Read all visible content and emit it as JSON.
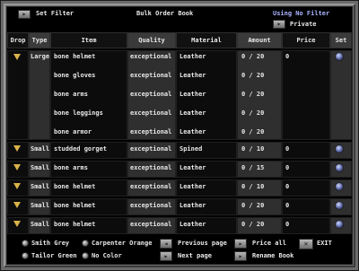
{
  "header": {
    "set_filter_label": "Set Filter",
    "title": "Bulk Order Book",
    "filter_status": "Using No Filter",
    "private_label": "Private"
  },
  "columns": [
    "Drop",
    "Type",
    "Item",
    "Quality",
    "Material",
    "Amount",
    "Price",
    "Set"
  ],
  "groups": [
    {
      "type": "Large",
      "items": [
        {
          "item": "bone helmet",
          "quality": "exceptional",
          "material": "Leather",
          "amount": "0 / 20",
          "price": "0"
        },
        {
          "item": "bone gloves",
          "quality": "exceptional",
          "material": "Leather",
          "amount": "0 / 20",
          "price": ""
        },
        {
          "item": "bone arms",
          "quality": "exceptional",
          "material": "Leather",
          "amount": "0 / 20",
          "price": ""
        },
        {
          "item": "bone leggings",
          "quality": "exceptional",
          "material": "Leather",
          "amount": "0 / 20",
          "price": ""
        },
        {
          "item": "bone armor",
          "quality": "exceptional",
          "material": "Leather",
          "amount": "0 / 20",
          "price": ""
        }
      ]
    },
    {
      "type": "Small",
      "items": [
        {
          "item": "studded gorget",
          "quality": "exceptional",
          "material": "Spined",
          "amount": "0 / 10",
          "price": "0"
        }
      ]
    },
    {
      "type": "Small",
      "items": [
        {
          "item": "bone arms",
          "quality": "exceptional",
          "material": "Leather",
          "amount": "0 / 15",
          "price": "0"
        }
      ]
    },
    {
      "type": "Small",
      "items": [
        {
          "item": "bone helmet",
          "quality": "exceptional",
          "material": "Leather",
          "amount": "0 / 10",
          "price": "0"
        }
      ]
    },
    {
      "type": "Small",
      "items": [
        {
          "item": "bone helmet",
          "quality": "exceptional",
          "material": "Leather",
          "amount": "0 / 20",
          "price": "0"
        }
      ]
    },
    {
      "type": "Small",
      "items": [
        {
          "item": "bone helmet",
          "quality": "exceptional",
          "material": "Leather",
          "amount": "0 / 20",
          "price": "0"
        }
      ]
    }
  ],
  "footer": {
    "smith": "Smith Grey",
    "carpenter": "Carpenter Orange",
    "tailor": "Tailor Green",
    "no_color": "No Color",
    "previous_page": "Previous page",
    "next_page": "Next page",
    "price_all": "Price all",
    "rename_book": "Rename Book",
    "exit": "EXIT"
  },
  "icons": {
    "drop": "drop-chevron-icon",
    "set": "set-gear-icon",
    "button": "arrow-button-icon",
    "exit": "close-x-icon"
  },
  "colors": {
    "background": "#000000",
    "frame": "#6a6a6a",
    "highlight_column": "#2f2f2f",
    "drop_icon": "#d9b24a",
    "set_icon": "#6d7ad0"
  }
}
